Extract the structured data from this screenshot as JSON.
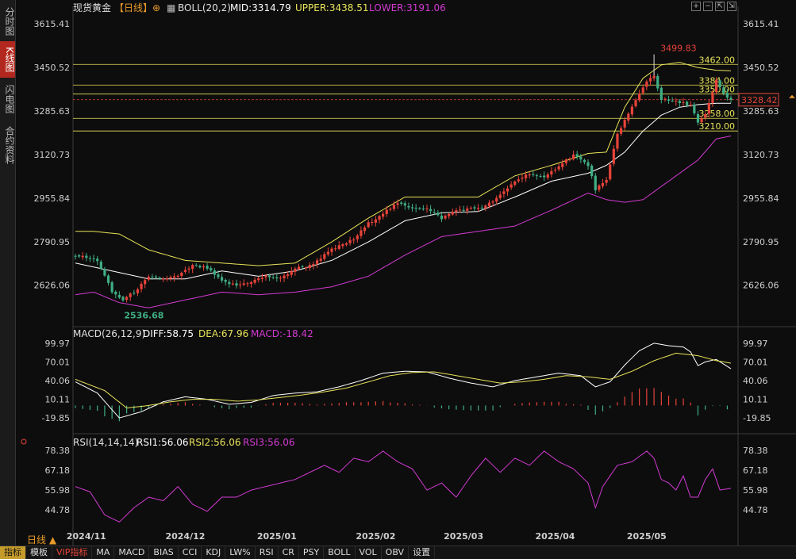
{
  "sidebar": {
    "tabs": [
      {
        "label": "分时图",
        "active": false
      },
      {
        "label": "K线图",
        "active": true
      },
      {
        "label": "闪电图",
        "active": false
      },
      {
        "label": "合约资料",
        "active": false
      }
    ]
  },
  "header": {
    "instrument": "现货黄金",
    "period_tag": "【日线】",
    "indicator": "BOLL(20,2)",
    "mid": "MID:3314.79",
    "upper": "UPPER:3438.51",
    "lower": "LOWER:3191.06",
    "window_buttons": [
      "plus-icon",
      "minus-icon",
      "expand-icon",
      "collapse-icon",
      "close-icon"
    ]
  },
  "colors": {
    "up": "#e8433a",
    "down": "#3fae84",
    "mid": "#ffffff",
    "upper": "#e8e35a",
    "lower": "#d23ad2",
    "diff": "#ffffff",
    "dea": "#e8e35a",
    "rsi1": "#ffffff",
    "rsi2": "#e8e35a",
    "rsi3": "#d23ad2",
    "hline": "#e8e35a",
    "accent": "#e89a2a"
  },
  "main_axis": {
    "left_ticks": [
      "3615.41",
      "3450.52",
      "3285.63",
      "3120.73",
      "2955.84",
      "2790.95",
      "2626.06"
    ],
    "right_ticks": [
      "3615.41",
      "3450.52",
      "3285.63",
      "3120.73",
      "2955.84",
      "2790.95",
      "2626.06"
    ],
    "tick_values": [
      3615.41,
      3450.52,
      3285.63,
      3120.73,
      2955.84,
      2790.95,
      2626.06
    ],
    "ylim": [
      2520,
      3640
    ]
  },
  "horizontal_levels": [
    {
      "value": 3462.0,
      "label": "3462.00"
    },
    {
      "value": 3384.0,
      "label": "3384.00"
    },
    {
      "value": 3350.0,
      "label": "3350.00"
    },
    {
      "value": 3258.0,
      "label": "3258.00"
    },
    {
      "value": 3210.0,
      "label": "3210.00"
    }
  ],
  "current_price": {
    "value": 3328.42,
    "label": "3328.42"
  },
  "annotations": {
    "high": {
      "value": 3499.83,
      "label": "3499.83"
    },
    "low": {
      "value": 2536.68,
      "label": "2536.68"
    }
  },
  "x_labels": [
    "2024/11",
    "2024/12",
    "2025/01",
    "2025/02",
    "2025/03",
    "2025/04",
    "2025/05"
  ],
  "macd": {
    "title": "MACD(26,12,9)",
    "diff_label": "DIFF:58.75",
    "dea_label": "DEA:67.96",
    "macd_label": "MACD:-18.42",
    "ticks": [
      "99.97",
      "70.01",
      "40.06",
      "10.11",
      "-19.85"
    ],
    "tick_values": [
      99.97,
      70.01,
      40.06,
      10.11,
      -19.85
    ],
    "ylim": [
      -30,
      110
    ]
  },
  "rsi": {
    "title": "RSI(14,14,14)",
    "rsi1_label": "RSI1:56.06",
    "rsi2_label": "RSI2:56.06",
    "rsi3_label": "RSI3:56.06",
    "ticks": [
      "78.38",
      "67.18",
      "55.98",
      "44.78"
    ],
    "tick_values": [
      78.38,
      67.18,
      55.98,
      44.78
    ],
    "ylim": [
      35,
      82
    ]
  },
  "period_selector": "日线",
  "toolbar": {
    "items": [
      {
        "label": "指标",
        "active": true
      },
      {
        "label": "模板",
        "active": false
      },
      {
        "label": "VIP指标",
        "vip": true
      },
      {
        "label": "MA"
      },
      {
        "label": "MACD"
      },
      {
        "label": "BIAS"
      },
      {
        "label": "CCI"
      },
      {
        "label": "KDJ"
      },
      {
        "label": "LW%"
      },
      {
        "label": "RSI"
      },
      {
        "label": "CR"
      },
      {
        "label": "PSY"
      },
      {
        "label": "BOLL"
      },
      {
        "label": "VOL"
      },
      {
        "label": "OBV"
      },
      {
        "label": "设置"
      }
    ]
  },
  "chart_data": {
    "type": "candlestick",
    "title": "现货黄金【日线】",
    "x": [
      "2024/11",
      "2024/12",
      "2025/01",
      "2025/02",
      "2025/03",
      "2025/04",
      "2025/05"
    ],
    "anchors": [
      [
        0,
        2740
      ],
      [
        6,
        2720
      ],
      [
        10,
        2600
      ],
      [
        13,
        2570
      ],
      [
        16,
        2600
      ],
      [
        20,
        2655
      ],
      [
        24,
        2650
      ],
      [
        28,
        2660
      ],
      [
        32,
        2700
      ],
      [
        36,
        2690
      ],
      [
        40,
        2640
      ],
      [
        44,
        2625
      ],
      [
        48,
        2640
      ],
      [
        52,
        2660
      ],
      [
        56,
        2650
      ],
      [
        60,
        2690
      ],
      [
        64,
        2700
      ],
      [
        70,
        2760
      ],
      [
        76,
        2800
      ],
      [
        80,
        2860
      ],
      [
        84,
        2900
      ],
      [
        88,
        2935
      ],
      [
        92,
        2920
      ],
      [
        96,
        2915
      ],
      [
        100,
        2880
      ],
      [
        104,
        2910
      ],
      [
        108,
        2915
      ],
      [
        112,
        2925
      ],
      [
        116,
        2965
      ],
      [
        120,
        3020
      ],
      [
        124,
        3050
      ],
      [
        128,
        3030
      ],
      [
        132,
        3080
      ],
      [
        136,
        3120
      ],
      [
        140,
        3080
      ],
      [
        142,
        2990
      ],
      [
        145,
        3020
      ],
      [
        148,
        3200
      ],
      [
        152,
        3300
      ],
      [
        156,
        3400
      ],
      [
        158,
        3420
      ],
      [
        160,
        3330
      ],
      [
        164,
        3320
      ],
      [
        168,
        3310
      ],
      [
        170,
        3240
      ],
      [
        172,
        3270
      ],
      [
        175,
        3400
      ],
      [
        177,
        3350
      ],
      [
        179,
        3328
      ]
    ],
    "boll_mid": [
      [
        0,
        2710
      ],
      [
        10,
        2680
      ],
      [
        20,
        2650
      ],
      [
        30,
        2650
      ],
      [
        40,
        2680
      ],
      [
        50,
        2660
      ],
      [
        60,
        2680
      ],
      [
        70,
        2720
      ],
      [
        80,
        2790
      ],
      [
        90,
        2870
      ],
      [
        100,
        2900
      ],
      [
        110,
        2905
      ],
      [
        120,
        2960
      ],
      [
        130,
        3020
      ],
      [
        140,
        3050
      ],
      [
        145,
        3080
      ],
      [
        150,
        3130
      ],
      [
        155,
        3210
      ],
      [
        160,
        3270
      ],
      [
        165,
        3300
      ],
      [
        170,
        3310
      ],
      [
        175,
        3315
      ],
      [
        179,
        3315
      ]
    ],
    "boll_upper": [
      [
        0,
        2830
      ],
      [
        5,
        2830
      ],
      [
        12,
        2820
      ],
      [
        20,
        2760
      ],
      [
        30,
        2720
      ],
      [
        40,
        2710
      ],
      [
        50,
        2700
      ],
      [
        60,
        2710
      ],
      [
        70,
        2790
      ],
      [
        80,
        2880
      ],
      [
        90,
        2960
      ],
      [
        100,
        2960
      ],
      [
        110,
        2960
      ],
      [
        120,
        3040
      ],
      [
        130,
        3080
      ],
      [
        140,
        3125
      ],
      [
        145,
        3130
      ],
      [
        150,
        3300
      ],
      [
        155,
        3410
      ],
      [
        160,
        3460
      ],
      [
        165,
        3470
      ],
      [
        170,
        3450
      ],
      [
        175,
        3440
      ],
      [
        179,
        3438
      ]
    ],
    "boll_lower": [
      [
        0,
        2590
      ],
      [
        5,
        2600
      ],
      [
        12,
        2560
      ],
      [
        20,
        2540
      ],
      [
        30,
        2570
      ],
      [
        40,
        2600
      ],
      [
        50,
        2590
      ],
      [
        60,
        2600
      ],
      [
        70,
        2620
      ],
      [
        80,
        2660
      ],
      [
        90,
        2740
      ],
      [
        100,
        2810
      ],
      [
        110,
        2830
      ],
      [
        120,
        2850
      ],
      [
        130,
        2910
      ],
      [
        140,
        2975
      ],
      [
        145,
        2950
      ],
      [
        150,
        2940
      ],
      [
        155,
        2950
      ],
      [
        160,
        3000
      ],
      [
        165,
        3050
      ],
      [
        170,
        3100
      ],
      [
        175,
        3180
      ],
      [
        179,
        3191
      ]
    ],
    "macd_diff": [
      [
        0,
        38
      ],
      [
        6,
        20
      ],
      [
        12,
        -20
      ],
      [
        18,
        -10
      ],
      [
        24,
        6
      ],
      [
        30,
        14
      ],
      [
        36,
        10
      ],
      [
        42,
        2
      ],
      [
        48,
        5
      ],
      [
        54,
        16
      ],
      [
        60,
        20
      ],
      [
        66,
        22
      ],
      [
        72,
        30
      ],
      [
        78,
        40
      ],
      [
        84,
        52
      ],
      [
        90,
        55
      ],
      [
        96,
        54
      ],
      [
        102,
        44
      ],
      [
        108,
        36
      ],
      [
        114,
        30
      ],
      [
        120,
        40
      ],
      [
        126,
        46
      ],
      [
        132,
        52
      ],
      [
        138,
        48
      ],
      [
        142,
        30
      ],
      [
        146,
        38
      ],
      [
        150,
        65
      ],
      [
        154,
        88
      ],
      [
        158,
        100
      ],
      [
        162,
        96
      ],
      [
        166,
        94
      ],
      [
        168,
        86
      ],
      [
        170,
        64
      ],
      [
        172,
        70
      ],
      [
        175,
        74
      ],
      [
        179,
        59
      ]
    ],
    "macd_dea": [
      [
        0,
        42
      ],
      [
        8,
        24
      ],
      [
        14,
        -4
      ],
      [
        20,
        0
      ],
      [
        26,
        6
      ],
      [
        32,
        10
      ],
      [
        38,
        10
      ],
      [
        44,
        7
      ],
      [
        50,
        9
      ],
      [
        56,
        13
      ],
      [
        62,
        17
      ],
      [
        68,
        22
      ],
      [
        74,
        28
      ],
      [
        80,
        38
      ],
      [
        86,
        48
      ],
      [
        92,
        53
      ],
      [
        98,
        54
      ],
      [
        104,
        48
      ],
      [
        110,
        42
      ],
      [
        116,
        36
      ],
      [
        122,
        38
      ],
      [
        128,
        42
      ],
      [
        134,
        48
      ],
      [
        140,
        46
      ],
      [
        146,
        42
      ],
      [
        152,
        55
      ],
      [
        158,
        72
      ],
      [
        164,
        84
      ],
      [
        170,
        80
      ],
      [
        175,
        72
      ],
      [
        179,
        68
      ]
    ],
    "rsi1": [
      [
        0,
        58
      ],
      [
        4,
        55
      ],
      [
        8,
        42
      ],
      [
        12,
        38
      ],
      [
        16,
        46
      ],
      [
        20,
        52
      ],
      [
        24,
        50
      ],
      [
        28,
        58
      ],
      [
        32,
        48
      ],
      [
        36,
        44
      ],
      [
        40,
        52
      ],
      [
        44,
        52
      ],
      [
        48,
        56
      ],
      [
        52,
        58
      ],
      [
        56,
        60
      ],
      [
        60,
        62
      ],
      [
        64,
        66
      ],
      [
        68,
        70
      ],
      [
        72,
        66
      ],
      [
        76,
        74
      ],
      [
        80,
        72
      ],
      [
        84,
        78
      ],
      [
        88,
        72
      ],
      [
        92,
        68
      ],
      [
        96,
        56
      ],
      [
        100,
        60
      ],
      [
        104,
        52
      ],
      [
        108,
        64
      ],
      [
        112,
        74
      ],
      [
        116,
        66
      ],
      [
        120,
        74
      ],
      [
        124,
        70
      ],
      [
        128,
        78
      ],
      [
        132,
        72
      ],
      [
        136,
        68
      ],
      [
        140,
        60
      ],
      [
        142,
        46
      ],
      [
        144,
        58
      ],
      [
        148,
        70
      ],
      [
        152,
        72
      ],
      [
        156,
        78
      ],
      [
        158,
        74
      ],
      [
        160,
        62
      ],
      [
        162,
        60
      ],
      [
        164,
        56
      ],
      [
        166,
        64
      ],
      [
        168,
        52
      ],
      [
        170,
        52
      ],
      [
        172,
        62
      ],
      [
        174,
        68
      ],
      [
        176,
        56
      ],
      [
        179,
        57
      ]
    ]
  }
}
